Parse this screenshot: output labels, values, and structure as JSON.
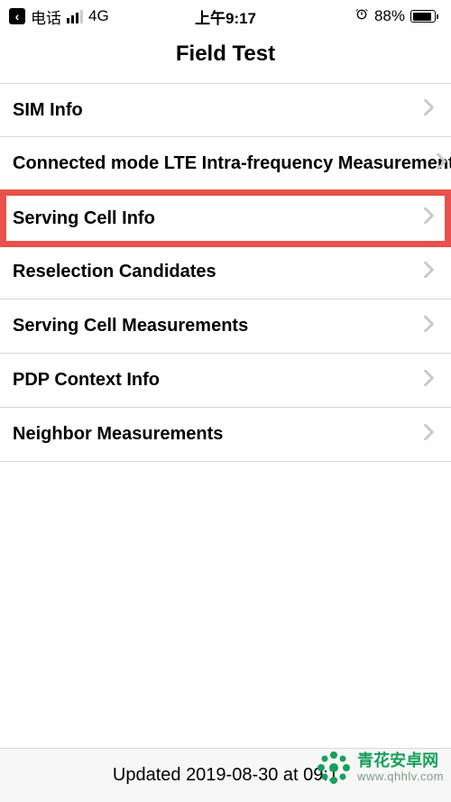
{
  "statusBar": {
    "carrier": "电话",
    "network": "4G",
    "time": "上午9:17",
    "batteryPercent": "88%"
  },
  "header": {
    "title": "Field Test"
  },
  "menu": {
    "items": [
      {
        "label": "SIM Info",
        "highlighted": false
      },
      {
        "label": "Connected mode LTE Intra-frequency Measurement",
        "highlighted": false
      },
      {
        "label": "Serving Cell Info",
        "highlighted": true
      },
      {
        "label": "Reselection Candidates",
        "highlighted": false
      },
      {
        "label": "Serving Cell Measurements",
        "highlighted": false
      },
      {
        "label": "PDP Context Info",
        "highlighted": false
      },
      {
        "label": "Neighbor Measurements",
        "highlighted": false
      }
    ]
  },
  "footer": {
    "updated": "Updated 2019-08-30 at 09:1"
  },
  "watermark": {
    "name": "青花安卓网",
    "url": "www.qhhlv.com"
  }
}
